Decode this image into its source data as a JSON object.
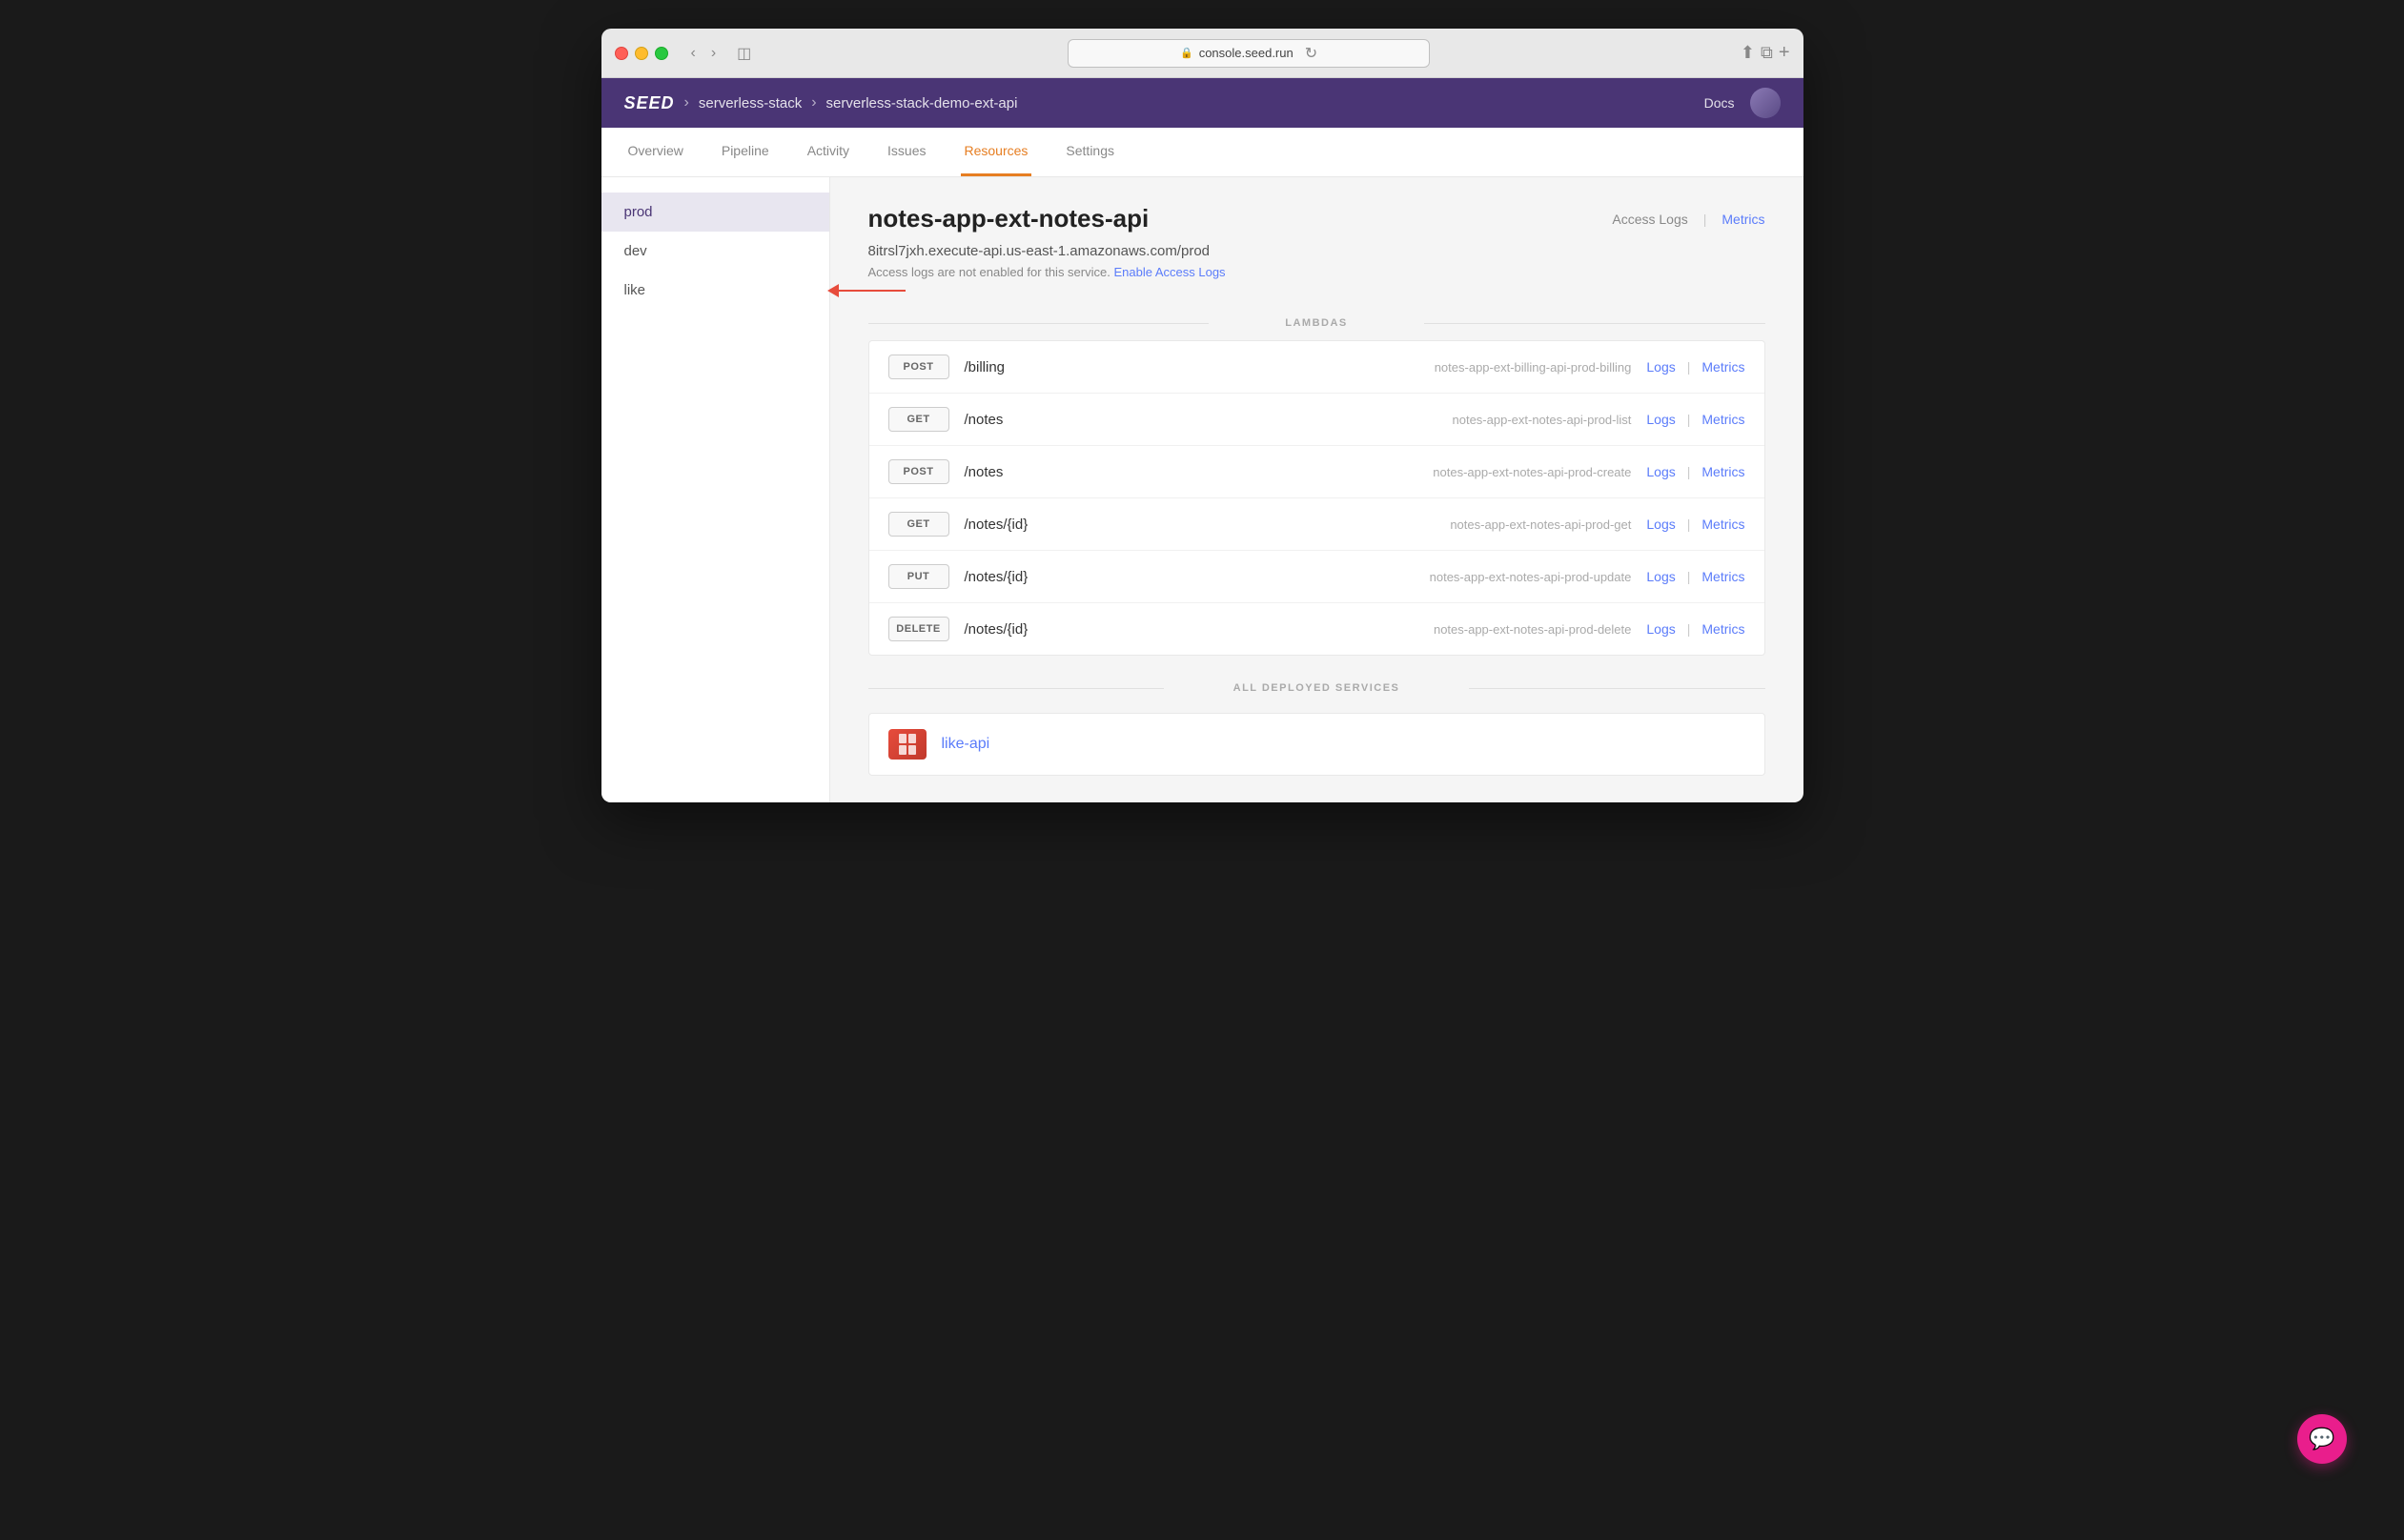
{
  "browser": {
    "url": "console.seed.run",
    "traffic_lights": [
      "red",
      "yellow",
      "green"
    ]
  },
  "app": {
    "logo": "SEED",
    "breadcrumbs": [
      "serverless-stack",
      "serverless-stack-demo-ext-api"
    ],
    "docs_label": "Docs"
  },
  "nav": {
    "tabs": [
      {
        "label": "Overview",
        "active": false
      },
      {
        "label": "Pipeline",
        "active": false
      },
      {
        "label": "Activity",
        "active": false
      },
      {
        "label": "Issues",
        "active": false
      },
      {
        "label": "Resources",
        "active": true
      },
      {
        "label": "Settings",
        "active": false
      }
    ]
  },
  "sidebar": {
    "items": [
      {
        "label": "prod",
        "active": true
      },
      {
        "label": "dev",
        "active": false
      },
      {
        "label": "like",
        "active": false,
        "has_arrow": true
      }
    ]
  },
  "service": {
    "title": "notes-app-ext-notes-api",
    "url": "8itrsl7jxh.execute-api.us-east-1.amazonaws.com/prod",
    "access_logs_notice": "Access logs are not enabled for this service.",
    "enable_logs_link": "Enable Access Logs",
    "actions": {
      "access_logs": "Access Logs",
      "metrics": "Metrics"
    }
  },
  "lambdas": {
    "section_label": "LAMBDAS",
    "rows": [
      {
        "method": "POST",
        "path": "/billing",
        "name": "notes-app-ext-billing-api-prod-billing",
        "logs_label": "Logs",
        "metrics_label": "Metrics"
      },
      {
        "method": "GET",
        "path": "/notes",
        "name": "notes-app-ext-notes-api-prod-list",
        "logs_label": "Logs",
        "metrics_label": "Metrics"
      },
      {
        "method": "POST",
        "path": "/notes",
        "name": "notes-app-ext-notes-api-prod-create",
        "logs_label": "Logs",
        "metrics_label": "Metrics"
      },
      {
        "method": "GET",
        "path": "/notes/{id}",
        "name": "notes-app-ext-notes-api-prod-get",
        "logs_label": "Logs",
        "metrics_label": "Metrics"
      },
      {
        "method": "PUT",
        "path": "/notes/{id}",
        "name": "notes-app-ext-notes-api-prod-update",
        "logs_label": "Logs",
        "metrics_label": "Metrics"
      },
      {
        "method": "DELETE",
        "path": "/notes/{id}",
        "name": "notes-app-ext-notes-api-prod-delete",
        "logs_label": "Logs",
        "metrics_label": "Metrics"
      }
    ]
  },
  "deployed_services": {
    "section_label": "ALL DEPLOYED SERVICES",
    "items": [
      {
        "name": "like-api"
      }
    ]
  },
  "chat_button": {
    "icon": "💬"
  }
}
